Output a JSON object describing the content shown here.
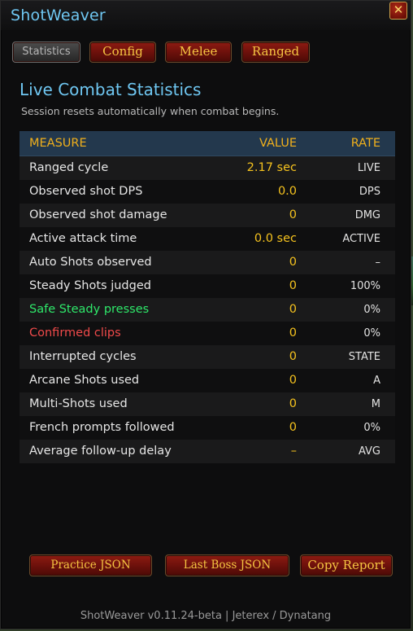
{
  "window": {
    "title": "ShotWeaver",
    "close_glyph": "✕"
  },
  "tabs": [
    {
      "label": "Statistics",
      "active": true
    },
    {
      "label": "Config",
      "active": false
    },
    {
      "label": "Melee",
      "active": false
    },
    {
      "label": "Ranged",
      "active": false
    }
  ],
  "section": {
    "title": "Live Combat Statistics",
    "subtitle": "Session resets automatically when combat begins."
  },
  "table": {
    "headers": {
      "measure": "MEASURE",
      "value": "VALUE",
      "rate": "RATE"
    },
    "rows": [
      {
        "label": "Ranged cycle",
        "value": "2.17 sec",
        "rate": "LIVE",
        "tone": "normal"
      },
      {
        "label": "Observed shot DPS",
        "value": "0.0",
        "rate": "DPS",
        "tone": "normal"
      },
      {
        "label": "Observed shot damage",
        "value": "0",
        "rate": "DMG",
        "tone": "normal"
      },
      {
        "label": "Active attack time",
        "value": "0.0 sec",
        "rate": "ACTIVE",
        "tone": "normal"
      },
      {
        "label": "Auto Shots observed",
        "value": "0",
        "rate": "–",
        "tone": "normal"
      },
      {
        "label": "Steady Shots judged",
        "value": "0",
        "rate": "100%",
        "tone": "normal"
      },
      {
        "label": "Safe Steady presses",
        "value": "0",
        "rate": "0%",
        "tone": "green"
      },
      {
        "label": "Confirmed clips",
        "value": "0",
        "rate": "0%",
        "tone": "red"
      },
      {
        "label": "Interrupted cycles",
        "value": "0",
        "rate": "STATE",
        "tone": "normal"
      },
      {
        "label": "Arcane Shots used",
        "value": "0",
        "rate": "A",
        "tone": "normal"
      },
      {
        "label": "Multi-Shots used",
        "value": "0",
        "rate": "M",
        "tone": "normal"
      },
      {
        "label": "French prompts followed",
        "value": "0",
        "rate": "0%",
        "tone": "normal"
      },
      {
        "label": "Average follow-up delay",
        "value": "–",
        "rate": "AVG",
        "tone": "normal"
      }
    ]
  },
  "buttons": {
    "practice": "Practice JSON",
    "last_boss": "Last Boss JSON",
    "copy_report": "Copy Report"
  },
  "footer": "ShotWeaver v0.11.24-beta  |  Jeterex / Dynatang",
  "colors": {
    "title_blue": "#6fc7f2",
    "gold": "#f5c21e",
    "header_bg": "#23384d",
    "button_red": "#8e1b12",
    "good_green": "#2ee86a",
    "bad_red": "#f04a4a"
  }
}
